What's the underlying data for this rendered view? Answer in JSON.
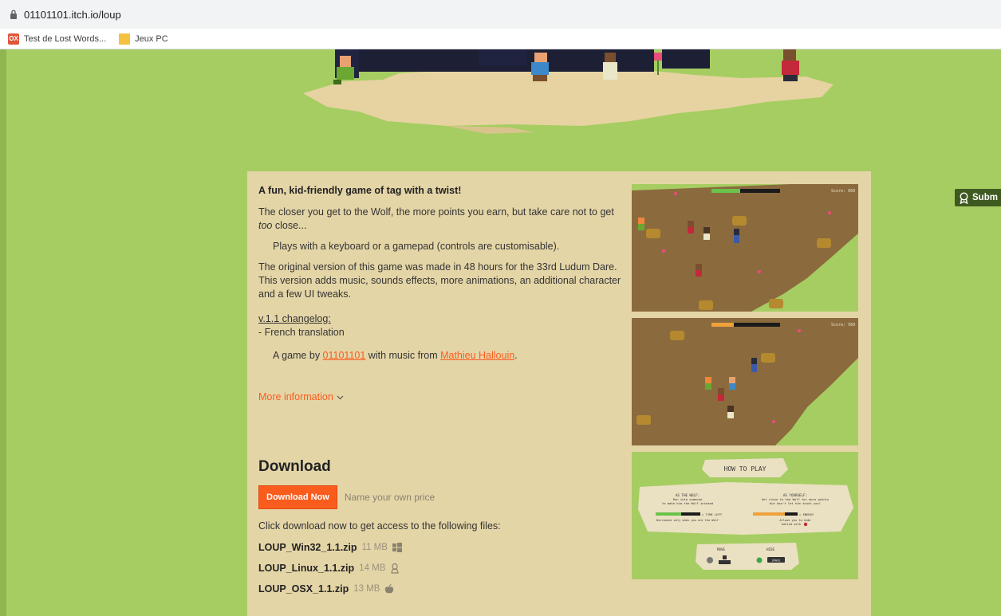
{
  "browser": {
    "url": "01101101.itch.io/loup",
    "bookmarks": [
      {
        "label": "Test de Lost Words...",
        "icon": "ox-favicon",
        "favicon_text": "OX"
      },
      {
        "label": "Jeux PC",
        "icon": "folder-icon"
      }
    ]
  },
  "side_action": {
    "label": "Subm",
    "icon": "award-ribbon-icon"
  },
  "description": {
    "lead": "A fun, kid-friendly game of tag with a twist!",
    "p1_before": "The closer you get to the Wolf, the more points you earn, but take care not to get ",
    "p1_em": "too",
    "p1_after": " close...",
    "p2": "Plays with a keyboard or a gamepad (controls are customisable).",
    "p3_line1": "The original version of this game was made in 48 hours for the 33rd Ludum Dare.",
    "p3_line2": "This version adds music, sounds effects, more animations, an additional character and a few UI tweaks.",
    "changelog_title": "v.1.1 changelog:",
    "changelog_item": "- French translation",
    "credits_before": "A game by ",
    "credits_author": "01101101",
    "credits_middle": " with music from ",
    "credits_musician": "Mathieu Hallouin",
    "credits_after": ".",
    "more_info": "More information"
  },
  "download": {
    "title": "Download",
    "button": "Download Now",
    "price_label": "Name your own price",
    "note": "Click download now to get access to the following files:",
    "files": [
      {
        "name": "LOUP_Win32_1.1.zip",
        "size": "11 MB",
        "os_icon": "windows-icon"
      },
      {
        "name": "LOUP_Linux_1.1.zip",
        "size": "14 MB",
        "os_icon": "linux-icon"
      },
      {
        "name": "LOUP_OSX_1.1.zip",
        "size": "13 MB",
        "os_icon": "apple-icon"
      }
    ]
  },
  "screenshots": {
    "score_label_1": "Score: 660",
    "score_label_2": "Score: 560",
    "howto": {
      "title": "HOW TO PLAY",
      "wolf_title": "AS THE WOLF:",
      "wolf_text_1": "Run into someone",
      "wolf_text_2": "to make him the Wolf instead",
      "you_title": "AS YOURSELF:",
      "you_text_1": "Get close to the Wolf for more points",
      "you_text_2": "but don't let him touch you!",
      "time_left": "= TIME LEFT",
      "time_note": "Decreases only when you are the Wolf",
      "energy": "= ENERGY",
      "energy_note_1": "Allows you to hide",
      "energy_note_2": "behind with",
      "move": "MOVE",
      "hide": "HIDE",
      "space_key": "SPACE"
    }
  },
  "colors": {
    "page_background": "#a6cd62",
    "panel_background": "#e4d5a7",
    "accent": "#fa5c1e",
    "dirt": "#8b6b3e"
  }
}
